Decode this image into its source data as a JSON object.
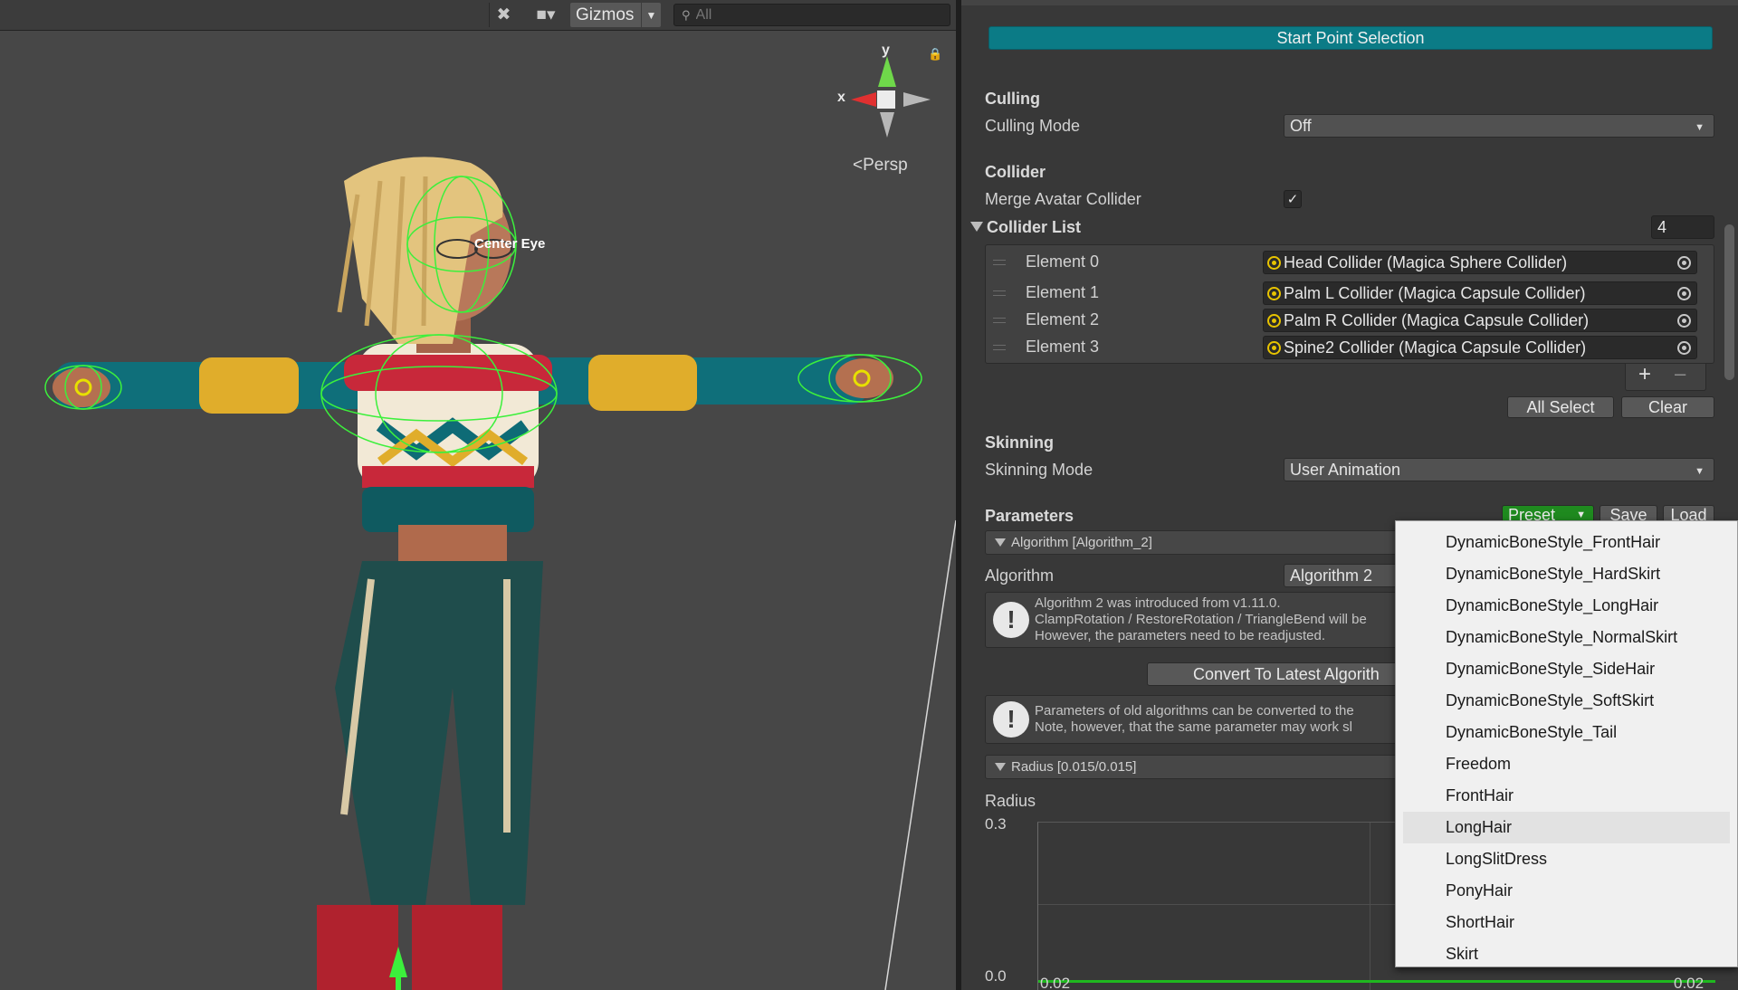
{
  "scene": {
    "toolbar": {
      "gizmos_label": "Gizmos",
      "search_placeholder": "All"
    },
    "axis_labels": {
      "x": "x",
      "y": "y"
    },
    "persp_label": "<Persp",
    "bone_label": "Center Eye"
  },
  "inspector": {
    "start_point_label": "Start Point Selection",
    "culling": {
      "heading": "Culling",
      "mode_label": "Culling Mode",
      "mode_value": "Off"
    },
    "collider": {
      "heading": "Collider",
      "merge_label": "Merge Avatar Collider",
      "merge_checked": true,
      "list_label": "Collider List",
      "list_count": "4",
      "elements": [
        {
          "label": "Element 0",
          "value": "Head Collider (Magica Sphere Collider)"
        },
        {
          "label": "Element 1",
          "value": "Palm L Collider (Magica Capsule Collider)"
        },
        {
          "label": "Element 2",
          "value": "Palm R Collider (Magica Capsule Collider)"
        },
        {
          "label": "Element 3",
          "value": "Spine2 Collider (Magica Capsule Collider)"
        }
      ],
      "all_select_label": "All Select",
      "clear_label": "Clear"
    },
    "skinning": {
      "heading": "Skinning",
      "mode_label": "Skinning Mode",
      "mode_value": "User Animation"
    },
    "parameters": {
      "heading": "Parameters",
      "preset_label": "Preset",
      "save_label": "Save",
      "load_label": "Load",
      "algorithm_foldout": "Algorithm [Algorithm_2]",
      "algorithm_label": "Algorithm",
      "algorithm_value": "Algorithm 2",
      "help1": [
        "Algorithm 2 was introduced from v1.11.0.",
        "ClampRotation / RestoreRotation / TriangleBend will be",
        "However, the parameters need to be readjusted."
      ],
      "convert_label": "Convert To Latest Algorith",
      "help2": [
        "Parameters of old algorithms can be converted to the",
        "Note, however, that the same parameter may work sl"
      ],
      "radius_foldout": "Radius [0.015/0.015]",
      "radius_label": "Radius",
      "graph_y_max": "0.3",
      "graph_y_min": "0.0",
      "graph_x_left": "0.02",
      "graph_x_right": "0.02"
    }
  },
  "preset_menu": {
    "items": [
      "DynamicBoneStyle_FrontHair",
      "DynamicBoneStyle_HardSkirt",
      "DynamicBoneStyle_LongHair",
      "DynamicBoneStyle_NormalSkirt",
      "DynamicBoneStyle_SideHair",
      "DynamicBoneStyle_SoftSkirt",
      "DynamicBoneStyle_Tail",
      "Freedom",
      "FrontHair",
      "LongHair",
      "LongSlitDress",
      "PonyHair",
      "ShortHair",
      "Skirt"
    ],
    "hover_index": 9
  },
  "colors": {
    "accent_button": "#0b7b86",
    "preset_button": "#1f8a1f",
    "collider_wire": "#3cf03c",
    "object_icon": "#e7c300"
  }
}
